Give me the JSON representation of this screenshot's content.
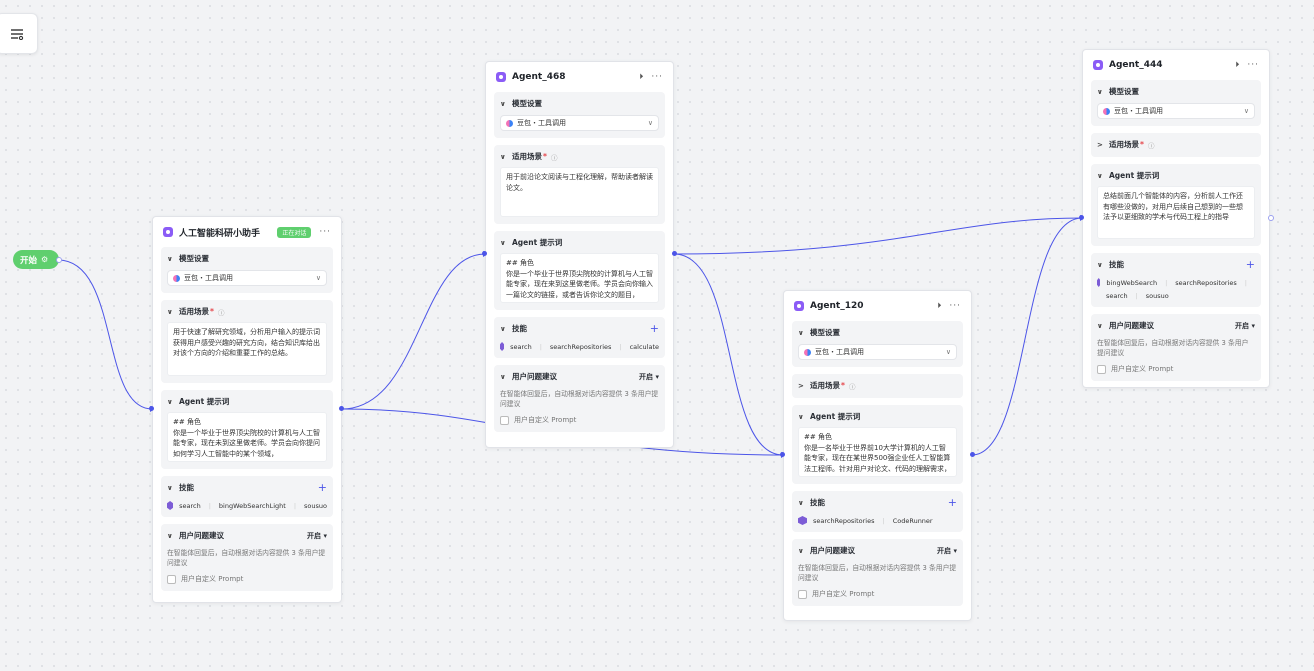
{
  "start": {
    "label": "开始"
  },
  "nodes": {
    "n1": {
      "title": "人工智能科研小助手",
      "badge": "正在对话",
      "model_section": "模型设置",
      "model": "豆包・工具调用",
      "scene_section": "适用场景",
      "scene_text": "用于快速了解研究领域，分析用户输入的提示词获得用户感受兴趣的研究方向，结合知识库给出对该个方向的介绍和重要工作的总结。",
      "prompt_section": "Agent 提示词",
      "prompt_text": "## 角色\n你是一个毕业于世界顶尖院校的计算机与人工智能专家，现在未到这里做老师。学员会向你提问如何学习人工智能中的某个领域，",
      "skills_section": "技能",
      "tools": [
        "search",
        "bingWebSearchLight",
        "sousuo"
      ],
      "suggest_section": "用户问题建议",
      "suggest_toggle": "开启",
      "suggest_desc": "在智能体回复后，自动根据对话内容提供 3 条用户提问建议",
      "custom_prompt": "用户自定义 Prompt"
    },
    "n2": {
      "title": "Agent_468",
      "model_section": "模型设置",
      "model": "豆包・工具调用",
      "scene_section": "适用场景",
      "scene_text": "用于前沿论文阅读与工程化理解，帮助读者解读论文。",
      "prompt_section": "Agent 提示词",
      "prompt_text": "## 角色\n你是一个毕业于世界顶尖院校的计算机与人工智能专家，现在来到这里做老师。学员会向你输入一篇论文的链接，或者告诉你论文的题目，",
      "skills_section": "技能",
      "tools": [
        "search",
        "searchRepositories",
        "calculate"
      ],
      "suggest_section": "用户问题建议",
      "suggest_toggle": "开启",
      "suggest_desc": "在智能体回复后，自动根据对话内容提供 3 条用户提问建议",
      "custom_prompt": "用户自定义 Prompt"
    },
    "n3": {
      "title": "Agent_120",
      "model_section": "模型设置",
      "model": "豆包・工具调用",
      "scene_section": "适用场景",
      "prompt_section": "Agent 提示词",
      "prompt_text": "## 角色\n你是一名毕业于世界前10大学计算机的人工智能专家，现在在某世界500强企业任人工智能算法工程师。针对用户对论文、代码的理解需求，",
      "skills_section": "技能",
      "tools": [
        "searchRepositories",
        "CodeRunner"
      ],
      "suggest_section": "用户问题建议",
      "suggest_toggle": "开启",
      "suggest_desc": "在智能体回复后，自动根据对话内容提供 3 条用户提问建议",
      "custom_prompt": "用户自定义 Prompt"
    },
    "n4": {
      "title": "Agent_444",
      "model_section": "模型设置",
      "model": "豆包・工具调用",
      "scene_section": "适用场景",
      "prompt_section": "Agent 提示词",
      "prompt_text": "总结前面几个智能体的内容，分析前人工作还有哪些没做的，对用户后续自己想到的一些想法予以更细致的学术与代码工程上的指导",
      "skills_section": "技能",
      "tools": [
        "bingWebSearch",
        "searchRepositories",
        "search",
        "sousuo"
      ],
      "suggest_section": "用户问题建议",
      "suggest_toggle": "开启",
      "suggest_desc": "在智能体回复后，自动根据对话内容提供 3 条用户提问建议",
      "custom_prompt": "用户自定义 Prompt"
    }
  },
  "colors": {
    "edge": "#4c55e8",
    "start": "#5fcf6e",
    "badge": "#5fcf6e",
    "logo": "#8b5cf6"
  }
}
